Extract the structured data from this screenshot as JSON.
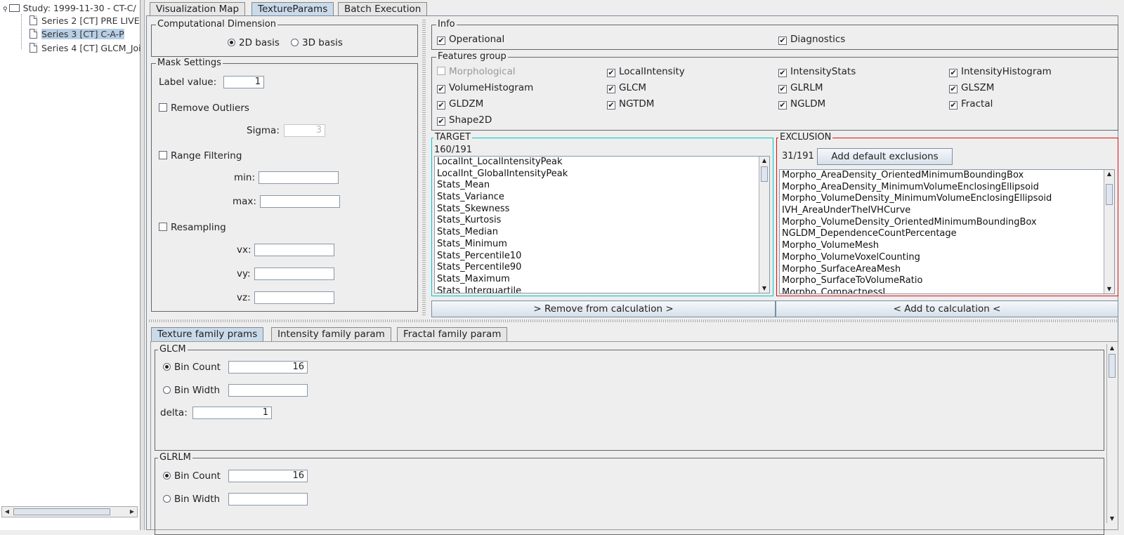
{
  "tree": {
    "study": "Study: 1999-11-30 - CT-C/",
    "series": [
      "Series 2 [CT] PRE LIVE",
      "Series 3 [CT] C-A-P",
      "Series 4 [CT] GLCM_Joi"
    ]
  },
  "main_tabs": [
    "Visualization Map",
    "TextureParams",
    "Batch Execution"
  ],
  "comp_dim": {
    "legend": "Computational Dimension",
    "opt_2d": "2D basis",
    "opt_3d": "3D basis"
  },
  "mask": {
    "legend": "Mask Settings",
    "label_value_label": "Label value:",
    "label_value": "1",
    "remove_outliers": "Remove Outliers",
    "sigma_label": "Sigma:",
    "sigma_value": "3",
    "range_filtering": "Range Filtering",
    "min_label": "min:",
    "max_label": "max:",
    "resampling": "Resampling",
    "vx_label": "vx:",
    "vy_label": "vy:",
    "vz_label": "vz:"
  },
  "info": {
    "legend": "Info",
    "operational": "Operational",
    "diagnostics": "Diagnostics"
  },
  "features": {
    "legend": "Features group",
    "items": [
      "Morphological",
      "LocalIntensity",
      "IntensityStats",
      "IntensityHistogram",
      "VolumeHistogram",
      "GLCM",
      "GLRLM",
      "GLSZM",
      "GLDZM",
      "NGTDM",
      "NGLDM",
      "Fractal",
      "Shape2D"
    ]
  },
  "target": {
    "legend": "TARGET",
    "count": "160/191",
    "items": [
      "LocalInt_LocalIntensityPeak",
      "LocalInt_GlobalIntensityPeak",
      "Stats_Mean",
      "Stats_Variance",
      "Stats_Skewness",
      "Stats_Kurtosis",
      "Stats_Median",
      "Stats_Minimum",
      "Stats_Percentile10",
      "Stats_Percentile90",
      "Stats_Maximum",
      "Stats_Interquartile"
    ]
  },
  "exclusion": {
    "legend": "EXCLUSION",
    "count": "31/191",
    "add_default": "Add default exclusions",
    "items": [
      "Morpho_AreaDensity_OrientedMinimumBoundingBox",
      "Morpho_AreaDensity_MinimumVolumeEnclosingEllipsoid",
      "Morpho_VolumeDensity_MinimumVolumeEnclosingEllipsoid",
      "IVH_AreaUnderTheIVHCurve",
      "Morpho_VolumeDensity_OrientedMinimumBoundingBox",
      "NGLDM_DependenceCountPercentage",
      "Morpho_VolumeMesh",
      "Morpho_VolumeVoxelCounting",
      "Morpho_SurfaceAreaMesh",
      "Morpho_SurfaceToVolumeRatio",
      "Morpho_CompactnessI"
    ]
  },
  "buttons": {
    "remove": "> Remove from calculation >",
    "add": "< Add to calculation <"
  },
  "sub_tabs": [
    "Texture family prams",
    "Intensity family param",
    "Fractal family param"
  ],
  "glcm": {
    "legend": "GLCM",
    "bin_count_label": "Bin Count",
    "bin_count": "16",
    "bin_width_label": "Bin Width",
    "delta_label": "delta:",
    "delta": "1"
  },
  "glrlm": {
    "legend": "GLRLM",
    "bin_count_label": "Bin Count",
    "bin_count": "16",
    "bin_width_label": "Bin Width"
  },
  "colors": {
    "target_border": "#00c8c8",
    "exclusion_border": "#e01010",
    "tab_active": "#c9daea"
  }
}
